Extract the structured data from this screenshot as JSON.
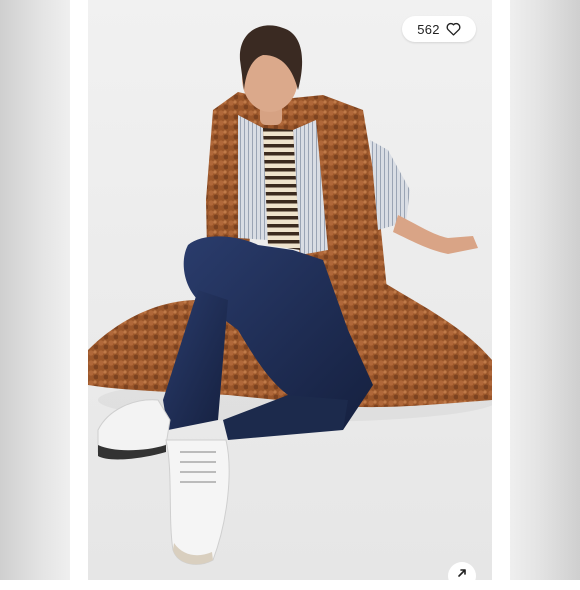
{
  "listing_photo": {
    "alt": ""
  },
  "likes": {
    "count": "562",
    "icon": "heart-outline-icon"
  },
  "expand": {
    "icon": "expand-arrow-icon"
  },
  "colors": {
    "frame_gray": "#dcdcdc",
    "backdrop": "#ececec",
    "coat": "#9c5a2c",
    "denim": "#1f2e55"
  }
}
